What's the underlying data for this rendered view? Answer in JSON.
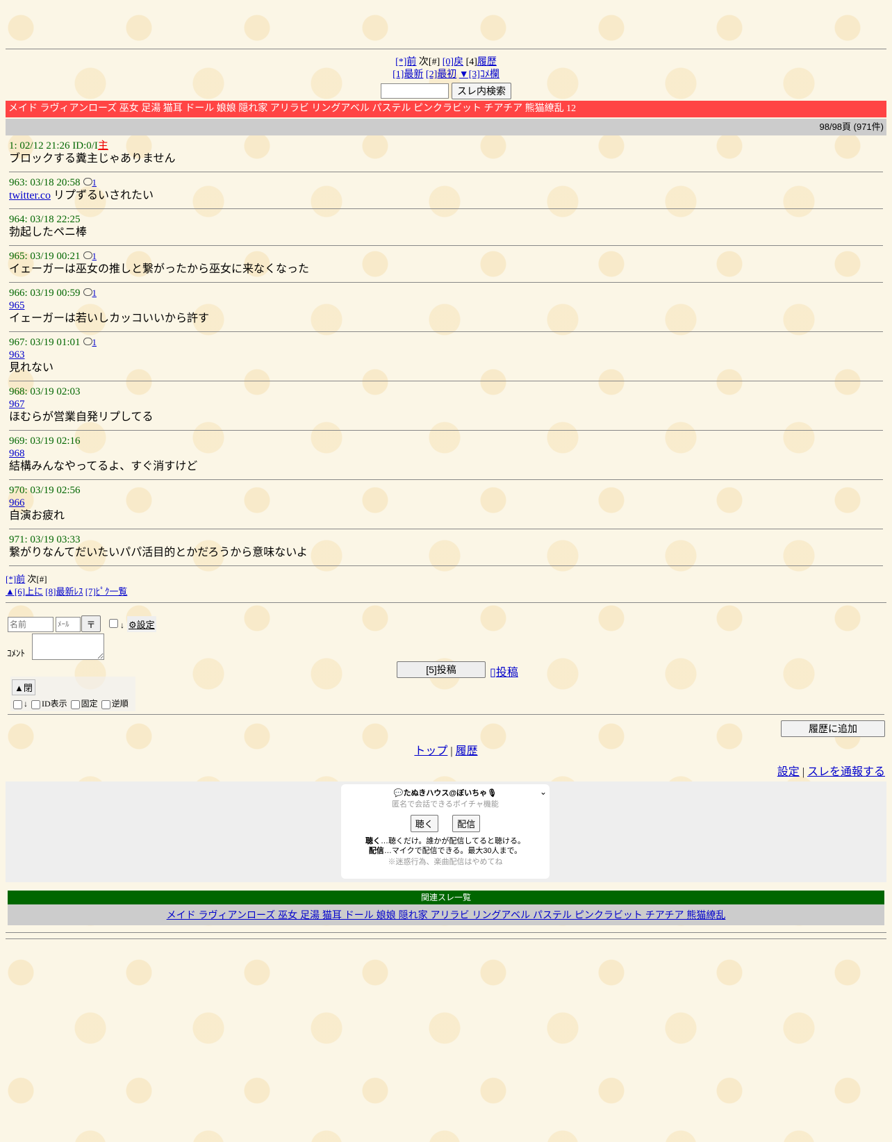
{
  "nav_top": {
    "prev": "[*]前",
    "next": "次[#]",
    "back": "[0]戻",
    "history_key": "[4]",
    "history": "履歴",
    "latest": "[1]最新",
    "first": "[2]最初",
    "comment": "▼[3]ｺﾒ欄"
  },
  "search": {
    "value": "",
    "button": "スレ内検索"
  },
  "tags_bar": "メイド ラヴィアンローズ 巫女 足湯 猫耳 ドール 娘娘 隠れ家 アリラビ リングアベル パステル ピンクラビット チアチア 熊猫繚乱 12",
  "page_info": "98/98頁 (971件)",
  "posts": [
    {
      "head": "1: 02/12 21:26 ID:0/I",
      "badge": "主",
      "reply_count": "",
      "ref": "",
      "link": "",
      "body": "ブロックする糞主じゃありません"
    },
    {
      "head": "963: 03/18 20:58",
      "badge": "",
      "reply_count": "1",
      "ref": "",
      "link": "twitter.co",
      "body": " リプずるいされたい"
    },
    {
      "head": "964: 03/18 22:25",
      "badge": "",
      "reply_count": "",
      "ref": "",
      "link": "",
      "body": "勃起したペニ棒"
    },
    {
      "head": "965: 03/19 00:21",
      "badge": "",
      "reply_count": "1",
      "ref": "",
      "link": "",
      "body": "イェーガーは巫女の推しと繋がったから巫女に来なくなった"
    },
    {
      "head": "966: 03/19 00:59",
      "badge": "",
      "reply_count": "1",
      "ref": "965",
      "link": "",
      "body": "イェーガーは若いしカッコいいから許す"
    },
    {
      "head": "967: 03/19 01:01",
      "badge": "",
      "reply_count": "1",
      "ref": "963",
      "link": "",
      "body": "見れない"
    },
    {
      "head": "968: 03/19 02:03",
      "badge": "",
      "reply_count": "",
      "ref": "967",
      "link": "",
      "body": "ほむらが営業自発リプしてる"
    },
    {
      "head": "969: 03/19 02:16",
      "badge": "",
      "reply_count": "",
      "ref": "968",
      "link": "",
      "body": "結構みんなやってるよ、すぐ消すけど"
    },
    {
      "head": "970: 03/19 02:56",
      "badge": "",
      "reply_count": "",
      "ref": "966",
      "link": "",
      "body": "自演お疲れ"
    },
    {
      "head": "971: 03/19 03:33",
      "badge": "",
      "reply_count": "",
      "ref": "",
      "link": "",
      "body": "繋がりなんてだいたいパパ活目的とかだろうから意味ないよ"
    }
  ],
  "nav_bottom": {
    "prev": "[*]前",
    "next": "次[#]",
    "up": "▲[6]上に",
    "latest_res": "[8]最新ﾚｽ",
    "pickup": "[7]ﾋﾟｸ一覧"
  },
  "form": {
    "name_placeholder": "名前",
    "mail_placeholder": "ﾒｰﾙ",
    "sage": "〒",
    "down": "↓",
    "settings": "設定",
    "comment_label": "ｺﾒﾝﾄ",
    "post_button": "[5]投稿",
    "post_link": "投稿",
    "close": "▲閉",
    "opt_down": "↓",
    "opt_id": "ID表示",
    "opt_fixed": "固定",
    "opt_reverse": "逆順"
  },
  "history_button": "履歴に追加",
  "links": {
    "top": "トップ",
    "sep": "|",
    "history": "履歴"
  },
  "right_links": {
    "settings": "設定",
    "sep": "|",
    "report": "スレを通報する"
  },
  "voice": {
    "title": "💬たぬきハウス@ぼいちゃ🎙",
    "subtitle": "匿名で会話できるボイチャ機能",
    "listen": "聴く",
    "broadcast": "配信",
    "listen_desc_label": "聴く",
    "listen_desc": "…聴くだけ。誰かが配信してると聴ける。",
    "broadcast_desc_label": "配信",
    "broadcast_desc": "…マイクで配信できる。最大30人まで。",
    "note": "※迷惑行為、楽曲配信はやめてね"
  },
  "related": {
    "header": "関連スレ一覧",
    "links": "メイド ラヴィアンローズ 巫女 足湯 猫耳 ドール 娘娘 隠れ家 アリラビ リングアベル パステル ピンクラビット チアチア 熊猫繚乱"
  }
}
